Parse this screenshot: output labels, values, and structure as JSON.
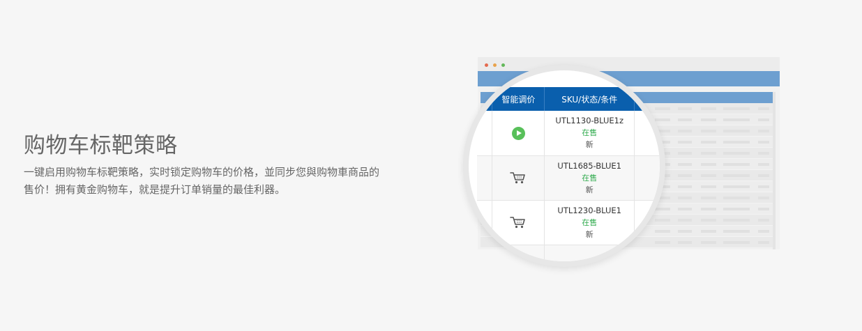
{
  "feature": {
    "title": "购物车标靶策略",
    "description": "一键启用购物车标靶策略，实时锁定购物车的价格，並同步您與购物車商品的售价！拥有黄金购物车，就是提升订单销量的最佳利器。"
  },
  "table": {
    "headers": {
      "smart_pricing": "智能调价",
      "sku_status_condition": "SKU/状态/条件"
    },
    "rows": [
      {
        "icon": "play-icon",
        "sku": "UTL1130-BLUE1z",
        "status": "在售",
        "condition": "新"
      },
      {
        "icon": "cart-icon",
        "sku": "UTL1685-BLUE1",
        "status": "在售",
        "condition": "新"
      },
      {
        "icon": "cart-icon",
        "sku": "UTL1230-BLUE1",
        "status": "在售",
        "condition": "新"
      }
    ]
  },
  "colors": {
    "header_blue": "#0a5fad",
    "status_green": "#2eaa4c",
    "play_green": "#58c05a"
  }
}
